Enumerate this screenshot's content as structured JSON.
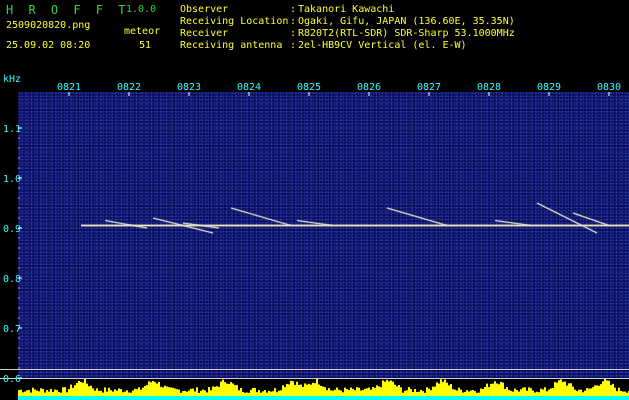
{
  "header": {
    "app_name": "H R O F F T",
    "app_version": "1.0.0",
    "filename": "2509020820.png",
    "datetime": "25.09.02 08:20",
    "meteor_label": "meteor",
    "meteor_count": "51"
  },
  "info": [
    {
      "key": "Observer",
      "value": "Takanori Kawachi"
    },
    {
      "key": "Receiving Location",
      "value": "Ogaki, Gifu, JAPAN (136.60E, 35.35N)"
    },
    {
      "key": "Receiver",
      "value": "R820T2(RTL-SDR) SDR-Sharp 53.1000MHz"
    },
    {
      "key": "Receiving antenna",
      "value": "2el-HB9CV Vertical (el. E-W)"
    }
  ],
  "colors": {
    "background": "#000000",
    "spectrogram_bg": "#0a0e5c",
    "title_green": "#35d24a",
    "label_yellow": "#ffff33",
    "label_cyan": "#33ffff",
    "carrier": "#e6f0ff",
    "power_yellow": "#ffff00",
    "power_cyan": "#00ffff"
  },
  "chart_data": {
    "type": "heatmap",
    "y_unit": "kHz",
    "y_ticks": [
      "1.1",
      "1.0",
      "0.9",
      "0.8",
      "0.7",
      "0.6"
    ],
    "x_ticks": [
      "0821",
      "0822",
      "0823",
      "0824",
      "0825",
      "0826",
      "0827",
      "0828",
      "0829",
      "0830"
    ],
    "xlim": [
      820,
      830
    ],
    "ylim": [
      0.6,
      1.2
    ],
    "carrier_khz": 0.905,
    "meteor_traces": [
      {
        "start_min": 821.6,
        "end_min": 822.3,
        "start_khz": 0.915,
        "end_khz": 0.9
      },
      {
        "start_min": 822.4,
        "end_min": 823.4,
        "start_khz": 0.92,
        "end_khz": 0.89
      },
      {
        "start_min": 822.9,
        "end_min": 823.5,
        "start_khz": 0.91,
        "end_khz": 0.9
      },
      {
        "start_min": 823.7,
        "end_min": 824.7,
        "start_khz": 0.94,
        "end_khz": 0.905
      },
      {
        "start_min": 824.8,
        "end_min": 825.4,
        "start_khz": 0.915,
        "end_khz": 0.905
      },
      {
        "start_min": 826.3,
        "end_min": 827.3,
        "start_khz": 0.94,
        "end_khz": 0.905
      },
      {
        "start_min": 828.1,
        "end_min": 828.7,
        "start_khz": 0.915,
        "end_khz": 0.905
      },
      {
        "start_min": 828.8,
        "end_min": 829.8,
        "start_khz": 0.95,
        "end_khz": 0.89
      },
      {
        "start_min": 829.4,
        "end_min": 830.0,
        "start_khz": 0.93,
        "end_khz": 0.905
      }
    ],
    "power_bursts_min": [
      821.2,
      822.4,
      823.6,
      824.7,
      825.1,
      826.3,
      827.2,
      828.1,
      829.2,
      829.9
    ]
  }
}
